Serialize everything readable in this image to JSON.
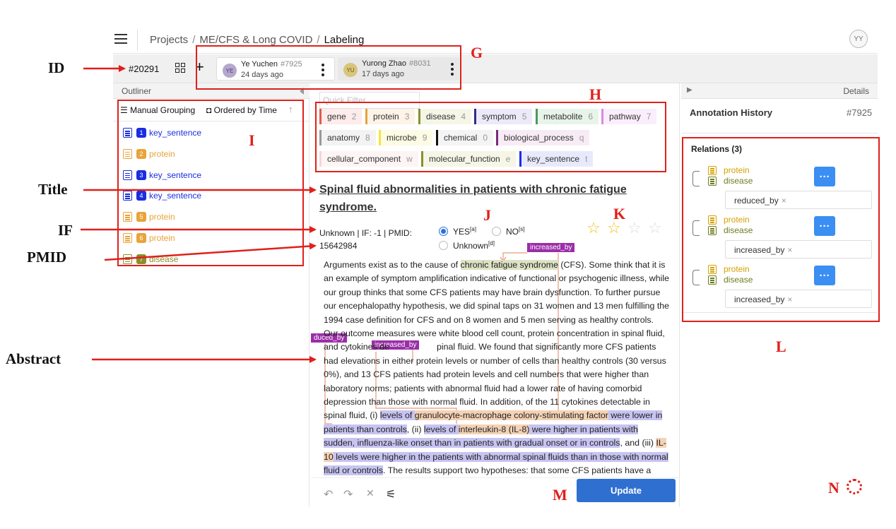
{
  "topbar": {
    "breadcrumb": [
      "Projects",
      "ME/CFS & Long COVID",
      "Labeling"
    ],
    "user_initials": "YY"
  },
  "tabbar": {
    "task_id": "#20291",
    "tabs": [
      {
        "initials": "YE",
        "name": "Ye Yuchen",
        "num": "#7925",
        "time": "24 days ago",
        "avatar_bg": "#b6a7cf"
      },
      {
        "initials": "YU",
        "name": "Yurong Zhao",
        "num": "#8031",
        "time": "17 days ago",
        "avatar_bg": "#d9c57a"
      }
    ]
  },
  "outliner": {
    "header": "Outliner",
    "manual_grouping": "Manual Grouping",
    "ordered_by": "Ordered by Time",
    "items": [
      {
        "num": "1",
        "label": "key_sentence",
        "color": "#1a2ee0"
      },
      {
        "num": "2",
        "label": "protein",
        "color": "#e8a33a"
      },
      {
        "num": "3",
        "label": "key_sentence",
        "color": "#1a2ee0"
      },
      {
        "num": "4",
        "label": "key_sentence",
        "color": "#1a2ee0"
      },
      {
        "num": "5",
        "label": "protein",
        "color": "#e8a33a"
      },
      {
        "num": "6",
        "label": "protein",
        "color": "#e8a33a"
      },
      {
        "num": "7",
        "label": "disease",
        "color": "#8a8f2a"
      }
    ]
  },
  "filter": {
    "placeholder": "Quick Filter",
    "labels": [
      {
        "name": "gene",
        "key": "2",
        "color": "#e05b4b",
        "bg": "#fdeceb"
      },
      {
        "name": "protein",
        "key": "3",
        "color": "#e8a33a",
        "bg": "#fdf3e6"
      },
      {
        "name": "disease",
        "key": "4",
        "color": "#8a8f2a",
        "bg": "#f5f6e6"
      },
      {
        "name": "symptom",
        "key": "5",
        "color": "#2f2e8a",
        "bg": "#eceaf8"
      },
      {
        "name": "metabolite",
        "key": "6",
        "color": "#4a9a5a",
        "bg": "#e8f4ea"
      },
      {
        "name": "pathway",
        "key": "7",
        "color": "#d68be0",
        "bg": "#fbeefc"
      },
      {
        "name": "anatomy",
        "key": "8",
        "color": "#999999",
        "bg": "#f3f3f3"
      },
      {
        "name": "microbe",
        "key": "9",
        "color": "#f2e63a",
        "bg": "#fdfbe4"
      },
      {
        "name": "chemical",
        "key": "0",
        "color": "#111111",
        "bg": "#f4f4f4"
      },
      {
        "name": "biological_process",
        "key": "q",
        "color": "#7a2a7a",
        "bg": "#f7ecf5"
      },
      {
        "name": "cellular_component",
        "key": "w",
        "color": "#f5d6d6",
        "bg": "#fdf4f4"
      },
      {
        "name": "molecular_function",
        "key": "e",
        "color": "#8a8f2a",
        "bg": "#f5f6e6"
      },
      {
        "name": "key_sentence",
        "key": "t",
        "color": "#1a2ee0",
        "bg": "#e8eafc"
      }
    ]
  },
  "document": {
    "title": "Spinal fluid abnormalities in patients with chronic fatigue syndrome.",
    "meta_1": "Unknown | IF: -1 | PMID:",
    "meta_2": "15642984",
    "radio_yes": "YES",
    "radio_yes_sup": "[a]",
    "radio_no": "NO",
    "radio_no_sup": "[s]",
    "radio_unknown": "Unknown",
    "radio_unknown_sup": "[d]",
    "stars_filled": 2,
    "stars_total": 4,
    "rel_tag_top": "increased_by",
    "rel_tag_left": "duced_by",
    "rel_tag_mid": "increased_by",
    "abstract": {
      "a1": "Arguments exist as to the cause of ",
      "a2": "chronic fatigue syndrome",
      "a3": " (CFS). Some think that it is an example of symptom amplification indicative of functional or psychogenic illness, while our group thinks that some CFS patients may have brain dysfunction. To further pursue our encephalopathy hypothesis, we did spinal taps on 31 women and 13 men fulfilling the 1994 case definition for CFS and on 8 women and 5 men serving as healthy controls. Our outcome measures were white blood cell count, protein concentration in spinal fluid, and cytokines de",
      "a4": "pinal fluid. We found that significantly more CFS patients had elevations in either protein levels or number of cells than healthy controls (30 versus 0%), and 13 CFS patients had protein levels and cell numbers that were higher than laboratory norms; patients with abnormal fluid had a lower rate of having comorbid depression than those with normal fluid. In addition, of the 11 cytokines detectable in spinal fluid, (i) ",
      "k1a": "levels of ",
      "p1": "granulocyte-macrophage colony-stimulating factor",
      "k1b": " were lower in patients than controls",
      "a5": ", (ii) ",
      "k2a": "levels of ",
      "p2": "interleukin-8 (IL-8)",
      "k2b": " were higher in patients with sudden, influenza-like onset than in patients with gradual onset or in controls",
      "a6": ", and (iii) ",
      "p3": "IL-10",
      "k3b": " levels were higher in the patients with abnormal spinal fluids than in those with normal fluid or controls",
      "a7": ". The results support two hypotheses: that some CFS patients have a neurological"
    },
    "update": "Update",
    "tools": {
      "undo": "↶",
      "redo": "↷",
      "clear": "✕",
      "settings": "⚟"
    }
  },
  "details": {
    "header": "Details",
    "annotation_history": "Annotation History",
    "annotation_num": "#7925",
    "relations_title": "Relations (3)",
    "relations": [
      {
        "source": "protein",
        "target": "disease",
        "type": "reduced_by"
      },
      {
        "source": "protein",
        "target": "disease",
        "type": "increased_by"
      },
      {
        "source": "protein",
        "target": "disease",
        "type": "increased_by"
      }
    ]
  },
  "annotations": {
    "left_labels": {
      "id": "ID",
      "title": "Title",
      "if": "IF",
      "pmid": "PMID",
      "abstract": "Abstract"
    },
    "letters": {
      "g": "G",
      "h": "H",
      "i": "I",
      "j": "J",
      "k": "K",
      "l": "L",
      "m": "M",
      "n": "N"
    }
  },
  "colors": {
    "accent": "#2f6fd0",
    "annotation_red": "#e0201a"
  }
}
